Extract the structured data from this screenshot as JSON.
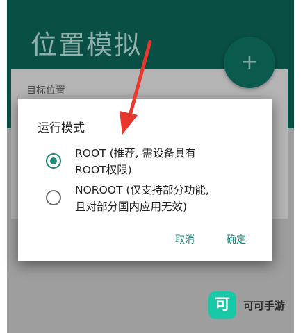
{
  "app": {
    "title": "位置模拟",
    "fab_symbol": "+",
    "card_label": "目标位置"
  },
  "dialog": {
    "title": "运行模式",
    "options": [
      {
        "line1": "ROOT (推荐, 需设备具有",
        "line2": "ROOT权限)",
        "selected": true
      },
      {
        "line1": "NOROOT (仅支持部分功能,",
        "line2": "且对部分国内应用无效)",
        "selected": false
      }
    ],
    "cancel_label": "取消",
    "confirm_label": "确定"
  },
  "annotation": {
    "arrow_color": "#e8372c"
  },
  "watermark": {
    "logo_char": "可",
    "text": "可可手游"
  },
  "colors": {
    "appbar": "#0a4f44",
    "accent": "#1e8a78"
  }
}
